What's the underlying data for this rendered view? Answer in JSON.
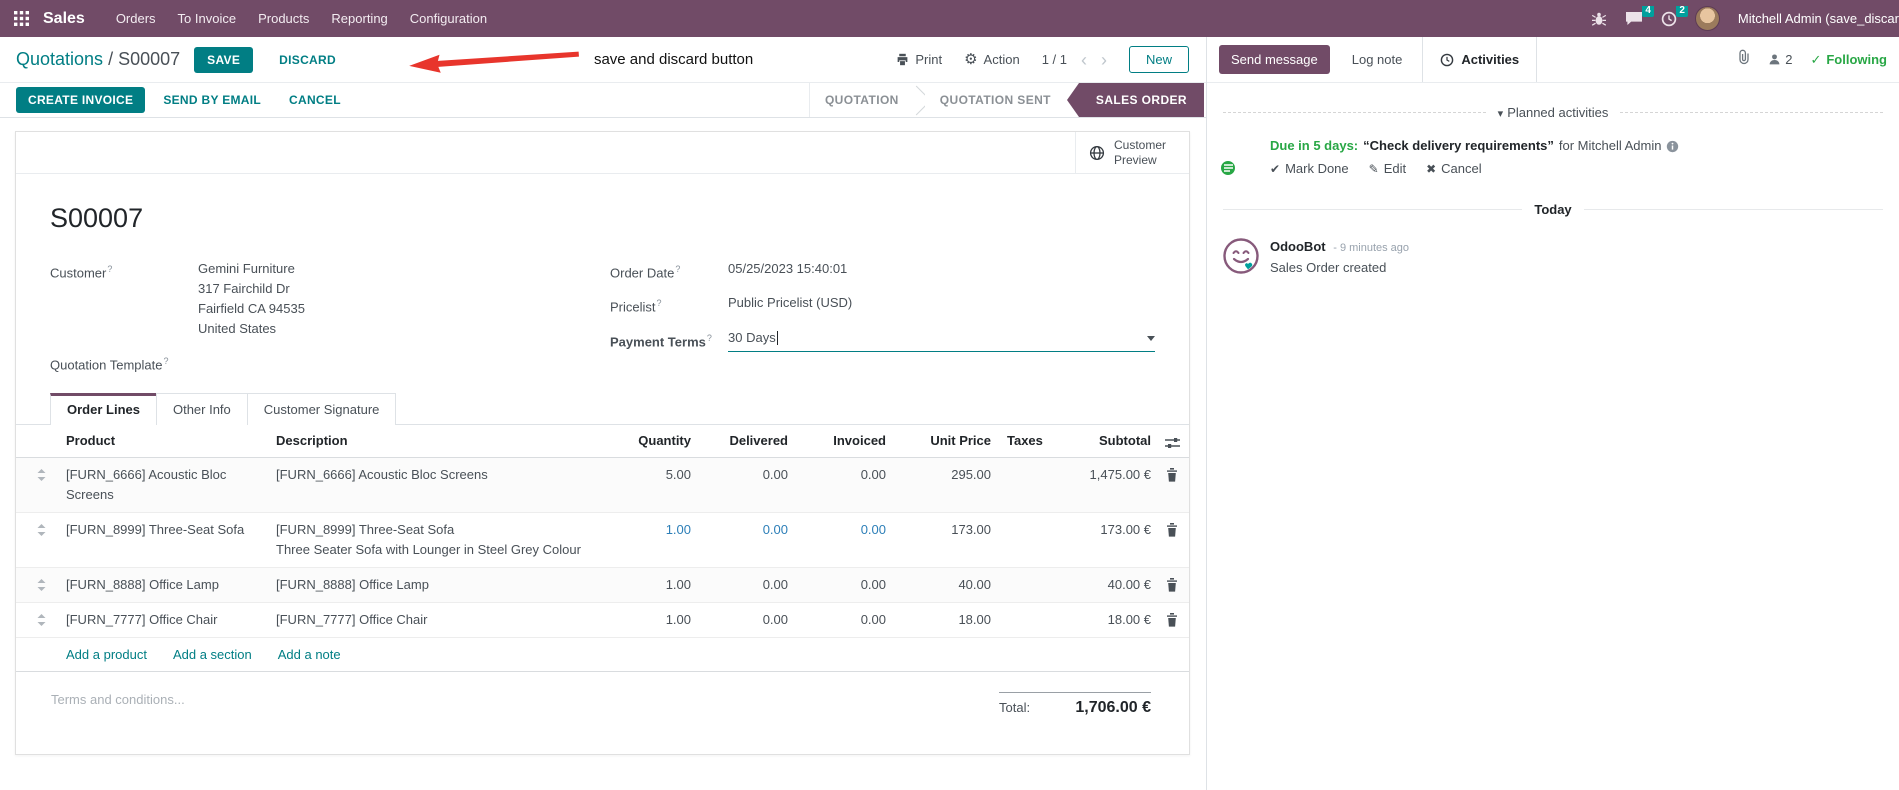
{
  "colors": {
    "purple": "#714B67",
    "primary": "#017E84",
    "badge": "#00A09D",
    "green": "#28a745",
    "modblue": "#2d7fb8",
    "arrow_red": "#e8352c"
  },
  "navbar": {
    "app_name": "Sales",
    "menus": [
      "Orders",
      "To Invoice",
      "Products",
      "Reporting",
      "Configuration"
    ],
    "message_badge": "4",
    "activity_badge": "2",
    "user_name": "Mitchell Admin (save_discar"
  },
  "control_panel": {
    "breadcrumb_parent": "Quotations",
    "breadcrumb_sep": "/",
    "breadcrumb_current": "S00007",
    "save_label": "SAVE",
    "discard_label": "DISCARD",
    "annotation_text": "save and discard button",
    "print_label": "Print",
    "action_label": "Action",
    "pager": "1 / 1",
    "new_label": "New"
  },
  "actions": {
    "create_invoice": "CREATE INVOICE",
    "send_by_email": "SEND BY EMAIL",
    "cancel": "CANCEL"
  },
  "statusbar": {
    "steps": [
      {
        "label": "QUOTATION"
      },
      {
        "label": "QUOTATION SENT"
      },
      {
        "label": "SALES ORDER"
      }
    ]
  },
  "sheet": {
    "preview_label": "Customer Preview",
    "title": "S00007",
    "help_marker": "?",
    "fields": {
      "customer_label": "Customer",
      "customer_name": "Gemini Furniture",
      "address_line1": "317 Fairchild Dr",
      "address_line2": "Fairfield CA 94535",
      "address_line3": "United States",
      "quotation_template_label": "Quotation Template",
      "order_date_label": "Order Date",
      "order_date_value": "05/25/2023 15:40:01",
      "pricelist_label": "Pricelist",
      "pricelist_value": "Public Pricelist (USD)",
      "payment_terms_label": "Payment Terms",
      "payment_terms_value": "30 Days"
    },
    "tabs": [
      "Order Lines",
      "Other Info",
      "Customer Signature"
    ],
    "table": {
      "headers": [
        "Product",
        "Description",
        "Quantity",
        "Delivered",
        "Invoiced",
        "Unit Price",
        "Taxes",
        "Subtotal"
      ],
      "rows": [
        {
          "product": "[FURN_6666] Acoustic Bloc Screens",
          "description": "[FURN_6666] Acoustic Bloc Screens",
          "quantity": "5.00",
          "delivered": "0.00",
          "invoiced": "0.00",
          "unit_price": "295.00",
          "subtotal": "1,475.00 €"
        },
        {
          "product": "[FURN_8999] Three-Seat Sofa",
          "description": "[FURN_8999] Three-Seat Sofa",
          "description2": "Three Seater Sofa with Lounger in Steel Grey Colour",
          "quantity": "1.00",
          "delivered": "0.00",
          "invoiced": "0.00",
          "unit_price": "173.00",
          "subtotal": "173.00 €"
        },
        {
          "product": "[FURN_8888] Office Lamp",
          "description": "[FURN_8888] Office Lamp",
          "quantity": "1.00",
          "delivered": "0.00",
          "invoiced": "0.00",
          "unit_price": "40.00",
          "subtotal": "40.00 €"
        },
        {
          "product": "[FURN_7777] Office Chair",
          "description": "[FURN_7777] Office Chair",
          "quantity": "1.00",
          "delivered": "0.00",
          "invoiced": "0.00",
          "unit_price": "18.00",
          "subtotal": "18.00 €"
        }
      ],
      "add_product": "Add a product",
      "add_section": "Add a section",
      "add_note": "Add a note"
    },
    "terms_placeholder": "Terms and conditions...",
    "total_label": "Total:",
    "total_value": "1,706.00 €"
  },
  "chatter": {
    "send_message": "Send message",
    "log_note": "Log note",
    "activities_tab": "Activities",
    "followers_count": "2",
    "following_label": "Following",
    "planned_header": "Planned activities",
    "activity": {
      "due": "Due in 5 days:",
      "summary": "“Check delivery requirements”",
      "for_text": "for Mitchell Admin",
      "mark_done": "Mark Done",
      "edit": "Edit",
      "cancel": "Cancel"
    },
    "today_label": "Today",
    "message": {
      "author": "OdooBot",
      "time": "- 9 minutes ago",
      "body": "Sales Order created"
    }
  },
  "icons": {
    "gear": "⚙",
    "chevron_left": "‹",
    "chevron_right": "›",
    "caret_down": "▾",
    "check": "✔",
    "pencil": "✎",
    "cross": "✖",
    "check_small": "✓"
  }
}
